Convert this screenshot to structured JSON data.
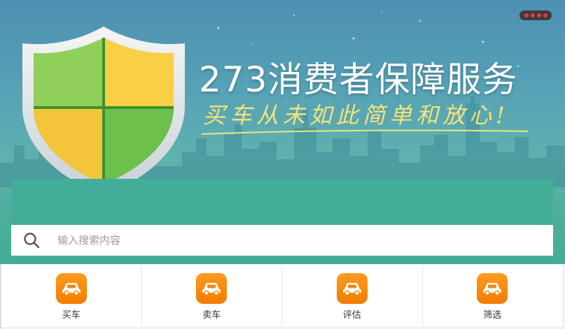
{
  "banner": {
    "title": "273消费者保障服务",
    "slogan": "买车从未如此简单和放心!",
    "carousel_indicator": "carousel-dots"
  },
  "search": {
    "placeholder": "输入搜索内容",
    "value": "",
    "icon": "search-icon"
  },
  "nav": {
    "items": [
      {
        "label": "买车",
        "icon": "car-icon"
      },
      {
        "label": "卖车",
        "icon": "car-icon"
      },
      {
        "label": "评估",
        "icon": "car-icon"
      },
      {
        "label": "筛选",
        "icon": "car-icon"
      }
    ]
  },
  "colors": {
    "banner_teal": "#43ad99",
    "icon_orange": "#f28a0f",
    "shield_green": "#7cc44a",
    "shield_yellow": "#f7c93c"
  }
}
